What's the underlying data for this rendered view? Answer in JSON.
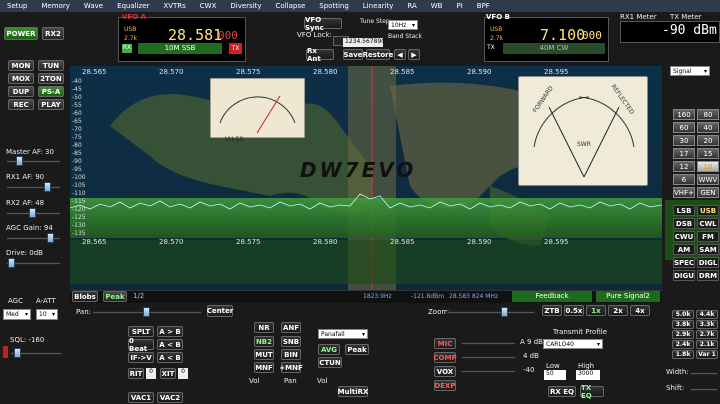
{
  "menu": [
    "Setup",
    "Memory",
    "Wave",
    "Equalizer",
    "XVTRs",
    "CWX",
    "Diversity",
    "Collapse",
    "Spotting",
    "Linearity",
    "RA",
    "WB",
    "PI",
    "BPF"
  ],
  "left": {
    "power": "POWER",
    "rx2": "RX2",
    "buttons": [
      "MON",
      "TUN",
      "MOX",
      "2TON",
      "DUP",
      "PS-A",
      "REC",
      "PLAY"
    ],
    "master_af": "Master AF: 30",
    "rx1_af": "RX1 AF: 90",
    "rx2_af": "RX2 AF: 48",
    "agc_gain": "AGC Gain: 94",
    "drive": "Drive: 0dB",
    "agc": "AGC",
    "a_att": "A-ATT",
    "agc_mode": "Med",
    "att_val": "10",
    "sql": "SQL: -160"
  },
  "vfo_a": {
    "label": "VFO A",
    "mode": "USB",
    "filter": "2.7k",
    "freq": "28.581",
    "freq_sub": "000",
    "band": "10M SSB",
    "rx": "RX",
    "tx": "TX"
  },
  "vfo_sync": {
    "vfo_sync": "VFO Sync",
    "vfo_lock": "VFO Lock:",
    "tune_step": "Tune Step:",
    "step_val": "10Hz",
    "band_stack": "Band Stack",
    "rx_ant": "Rx Ant",
    "freq_entry": "1234.567890",
    "save": "Save",
    "restore": "Restore"
  },
  "vfo_b": {
    "label": "VFO B",
    "mode": "USB",
    "filter": "2.7k",
    "freq": "7.100",
    "freq_sub": "000",
    "band": "40M CW",
    "rx": "RX",
    "tx": "TX"
  },
  "meters": {
    "rx1": "RX1 Meter",
    "tx": "TX Meter",
    "value": "-90 dBm",
    "signal": "Signal"
  },
  "pan": {
    "ticks_top": [
      "28.565",
      "28.570",
      "28.575",
      "28.580",
      "28.585",
      "28.590",
      "28.595"
    ],
    "ticks_bottom": [
      "28.565",
      "28.570",
      "28.575",
      "28.580",
      "28.585",
      "28.590",
      "28.595"
    ],
    "db": [
      "-40",
      "-45",
      "-50",
      "-55",
      "-60",
      "-65",
      "-70",
      "-75",
      "-80",
      "-85",
      "-90",
      "-95",
      "-100",
      "-105",
      "-110",
      "-115",
      "-120",
      "-125",
      "-130",
      "-135"
    ],
    "watermark": "DW7EVO",
    "vu_left": "VU-50",
    "swr_forward": "FORWARD",
    "swr_reflected": "REFLECTED",
    "swr": "SWR"
  },
  "status": {
    "blobs": "Blobs",
    "peak": "Peak",
    "frac": "1/2",
    "offset": "1823.9Hz",
    "dbm": "-121.8dBm",
    "freq": "28.583 824 MHz",
    "feedback": "Feedback",
    "pure_signal": "Pure Signal2"
  },
  "bands": [
    "160",
    "80",
    "60",
    "40",
    "30",
    "20",
    "17",
    "15",
    "12",
    "10",
    "6",
    "WWV",
    "VHF+",
    "GEN"
  ],
  "modes": [
    "LSB",
    "USB",
    "DSB",
    "CWL",
    "CWU",
    "FM",
    "AM",
    "SAM",
    "SPEC",
    "DIGL",
    "DIGU",
    "DRM"
  ],
  "bottom": {
    "pan": "Pan:",
    "center": "Center",
    "zoom": "Zoom:",
    "zoom_btns": [
      "ZTB",
      "0.5x",
      "1x",
      "2x",
      "4x"
    ],
    "splt": "SPLT",
    "a_b": "A > B",
    "zero_beat": "0 Beat",
    "a_lt_b": "A < B",
    "if_v": "IF->V",
    "a_swap_b": "A < B",
    "rit": "RIT",
    "rit_val": "0",
    "xit": "XIT",
    "xit_val": "0",
    "vac1": "VAC1",
    "vac2": "VAC2",
    "nr": "NR",
    "anf": "ANF",
    "nb2": "NB2",
    "snb": "SNB",
    "mut": "MUT",
    "bin": "BIN",
    "mnf": "MNF",
    "plus_mnf": "+MNF",
    "panafall": "Panafall",
    "avg": "AVG",
    "peak": "Peak",
    "ctun": "CTUN",
    "multirx": "MultiRX",
    "vol": "Vol",
    "pan_lbl": "Pan",
    "mic": "MIC",
    "comp": "COMP",
    "vox": "VOX",
    "dexp": "DEXP",
    "mic_db": "A 9 dB",
    "comp_db": "4 dB",
    "vox_db": "-40",
    "tx_profile": "Transmit Profile",
    "profile_val": "CARLO40",
    "low": "Low",
    "high": "High",
    "low_val": "50",
    "high_val": "3000",
    "rx_eq": "RX EQ",
    "tx_eq": "TX EQ",
    "pa_profile": "PA Profile: Default - HERMESLITE",
    "width": "Width:",
    "shift": "Shift:",
    "filters": [
      "5.0k",
      "4.4k",
      "3.8k",
      "3.3k",
      "2.9k",
      "2.7k",
      "2.4k",
      "2.1k",
      "1.8k",
      "Var 1"
    ]
  }
}
